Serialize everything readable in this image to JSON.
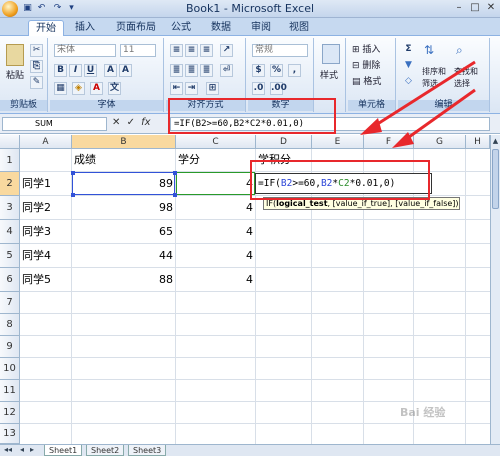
{
  "window": {
    "title": "Book1 - Microsoft Excel"
  },
  "tabs": [
    "开始",
    "插入",
    "页面布局",
    "公式",
    "数据",
    "审阅",
    "视图"
  ],
  "ribbon": {
    "paste_label": "粘贴",
    "font_name": "宋体",
    "font_size": "11",
    "number_format": "常规",
    "style_label": "样式",
    "insert_label": "插入",
    "delete_label": "删除",
    "format_label": "格式",
    "sort_label": "排序和筛选",
    "find_label": "查找和选择",
    "groups": {
      "clipboard": "剪贴板",
      "font": "字体",
      "alignment": "对齐方式",
      "number": "数字",
      "cells": "单元格",
      "editing": "编辑"
    }
  },
  "formula_bar": {
    "name_box": "SUM",
    "formula": "=IF(B2>=60,B2*C2*0.01,0)"
  },
  "columns": [
    "A",
    "B",
    "C",
    "D",
    "E",
    "F",
    "G",
    "H"
  ],
  "rows": [
    "1",
    "2",
    "3",
    "4",
    "5",
    "6",
    "7",
    "8",
    "9",
    "10",
    "11",
    "12",
    "13"
  ],
  "cells": {
    "B1": "成绩",
    "C1": "学分",
    "D1": "学积分",
    "A2": "同学1",
    "B2": "89",
    "C2": "4",
    "A3": "同学2",
    "B3": "98",
    "C3": "4",
    "A4": "同学3",
    "B4": "65",
    "C4": "4",
    "A5": "同学4",
    "B5": "44",
    "C5": "4",
    "A6": "同学5",
    "B6": "88",
    "C6": "4"
  },
  "edit_cell": {
    "prefix": "=IF(",
    "ref1": "B2",
    "mid": ">=60,",
    "ref2": "B2",
    "op": "*",
    "ref3": "C2",
    "suffix": "*0.01,0)"
  },
  "tooltip": {
    "func": "IF(",
    "arg1": "logical_test",
    "rest": ", [value_if_true], [value_if_false])"
  },
  "sheets": [
    "Sheet1",
    "Sheet2",
    "Sheet3"
  ],
  "watermark": "Bai 经验",
  "colors": {
    "annotation_red": "#e8282c",
    "ref_blue": "#2a44d8",
    "ref_green": "#2a8c2a"
  }
}
